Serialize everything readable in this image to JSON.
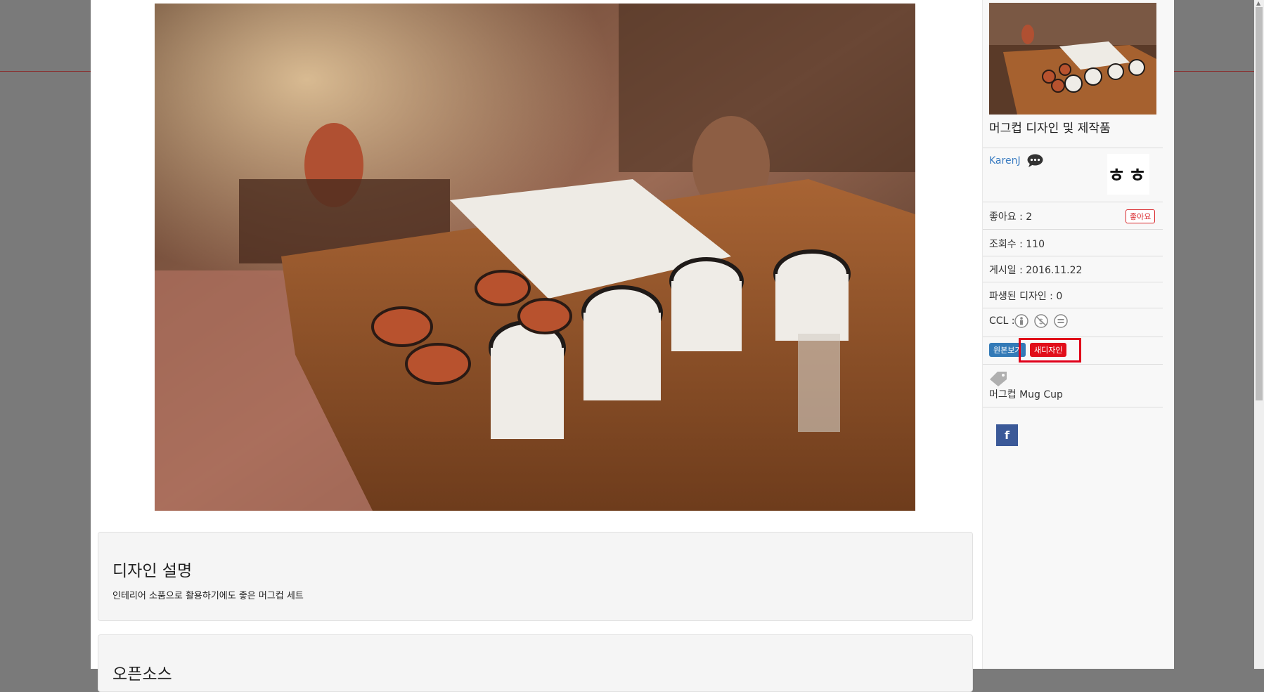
{
  "main": {
    "description_title": "디자인 설명",
    "description_text": "인테리어 소품으로 활용하기에도 좋은 머그컵 세트",
    "open_source_title": "오픈소스"
  },
  "sidebar": {
    "product_title": "머그컵 디자인 및 제작품",
    "author": "KarenJ",
    "avatar_text": "ㅎㅎ",
    "likes_text": "좋아요 : 2",
    "like_button": "좋아요",
    "views_text": "조회수 : 110",
    "posted_text": "게시일 : 2016.11.22",
    "derived_text": "파생된 디자인 : 0",
    "ccl_label": "CCL :",
    "badge_original": "원본보기",
    "badge_new": "새디자인",
    "tags_text": "머그컵 Mug Cup",
    "facebook_label": "f"
  },
  "icons": [
    "chat-bubble-icon",
    "ccl-by-icon",
    "ccl-nc-icon",
    "ccl-nd-icon",
    "tag-icon",
    "facebook-icon"
  ],
  "colors": {
    "accent_red": "#e10e1a",
    "link_blue": "#3b7cc1",
    "facebook_blue": "#3b5998",
    "badge_blue": "#337ab7"
  }
}
